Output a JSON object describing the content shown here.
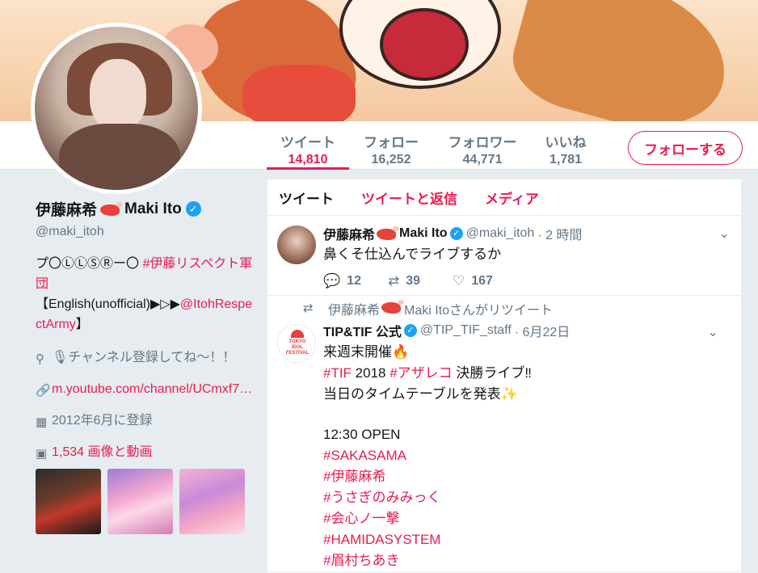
{
  "profile": {
    "name": "伊藤麻希",
    "name_suffix": "Maki Ito",
    "handle": "@maki_itoh",
    "bio_line1": "プ〇ⓁⓁⓈⓇー〇 ",
    "bio_tag": "#伊藤リスペクト軍団",
    "bio_line2": "【English(unofficial)▶▷▶",
    "bio_mention": "@ItohRespectArmy",
    "bio_line2_end": "】",
    "location": "🎙チャンネル登録してね〜！！",
    "website": "m.youtube.com/channel/UCmxf7…",
    "joined": "2012年6月に登録",
    "media_count": "1,534 画像と動画"
  },
  "stats": [
    {
      "label": "ツイート",
      "value": "14,810"
    },
    {
      "label": "フォロー",
      "value": "16,252"
    },
    {
      "label": "フォロワー",
      "value": "44,771"
    },
    {
      "label": "いいね",
      "value": "1,781"
    }
  ],
  "follow_label": "フォローする",
  "tabs": [
    "ツイート",
    "ツイートと返信",
    "メディア"
  ],
  "tweet1": {
    "name": "伊藤麻希",
    "name_suffix": "Maki Ito",
    "handle": "@maki_itoh",
    "time": "· 2 時間",
    "text": "鼻くそ仕込んでライブするか",
    "replies": "12",
    "retweets": "39",
    "likes": "167"
  },
  "tweet2": {
    "retweet_note": "伊藤麻希",
    "retweet_note_suffix": "Maki Itoさんがリツイート",
    "name": "TIP&TIF 公式",
    "handle": "@TIP_TIF_staff",
    "time": "· 6月22日",
    "logo_text": "TOKYO IDOL FESTIVAL",
    "line1": "来週末開催🔥",
    "line2_tag1": "#TIF",
    "line2_mid": " 2018 ",
    "line2_tag2": "#アザレコ",
    "line2_end": " 決勝ライブ‼",
    "line3": "当日のタイムテーブルを発表✨",
    "line4": "12:30 OPEN",
    "tags": [
      "#SAKASAMA",
      "#伊藤麻希",
      "#うさぎのみみっく",
      "#会心ノ一撃",
      "#HAMIDASYSTEM",
      "#眉村ちあき"
    ]
  },
  "colors": {
    "accent": "#e81c4f",
    "verified": "#1da1f2",
    "muted": "#657786"
  }
}
